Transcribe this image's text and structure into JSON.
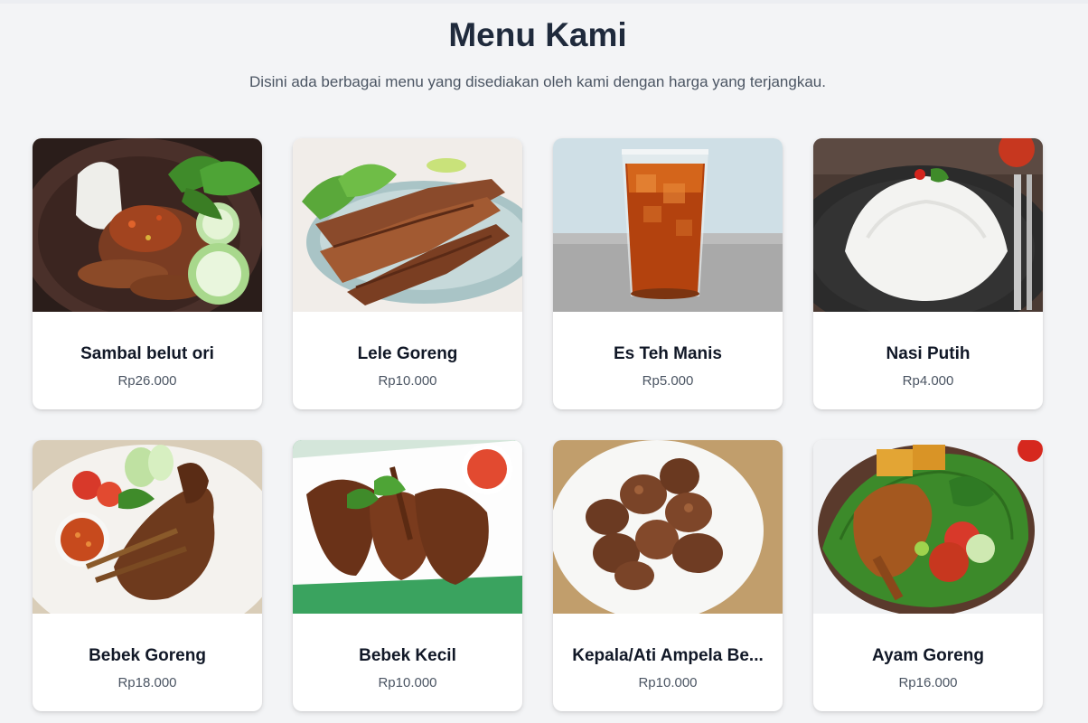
{
  "header": {
    "title": "Menu Kami",
    "subtitle": "Disini ada berbagai menu yang disediakan oleh kami dengan harga yang terjangkau."
  },
  "menu": [
    {
      "name": "Sambal belut ori",
      "price": "Rp26.000"
    },
    {
      "name": "Lele Goreng",
      "price": "Rp10.000"
    },
    {
      "name": "Es Teh Manis",
      "price": "Rp5.000"
    },
    {
      "name": "Nasi Putih",
      "price": "Rp4.000"
    },
    {
      "name": "Bebek Goreng",
      "price": "Rp18.000"
    },
    {
      "name": "Bebek Kecil",
      "price": "Rp10.000"
    },
    {
      "name": "Kepala/Ati Ampela Be...",
      "price": "Rp10.000"
    },
    {
      "name": "Ayam Goreng",
      "price": "Rp16.000"
    }
  ],
  "colors": {
    "page_background": "#f3f4f6",
    "card_background": "#ffffff",
    "title_text": "#1f2a3c",
    "body_text": "#4b5563"
  }
}
